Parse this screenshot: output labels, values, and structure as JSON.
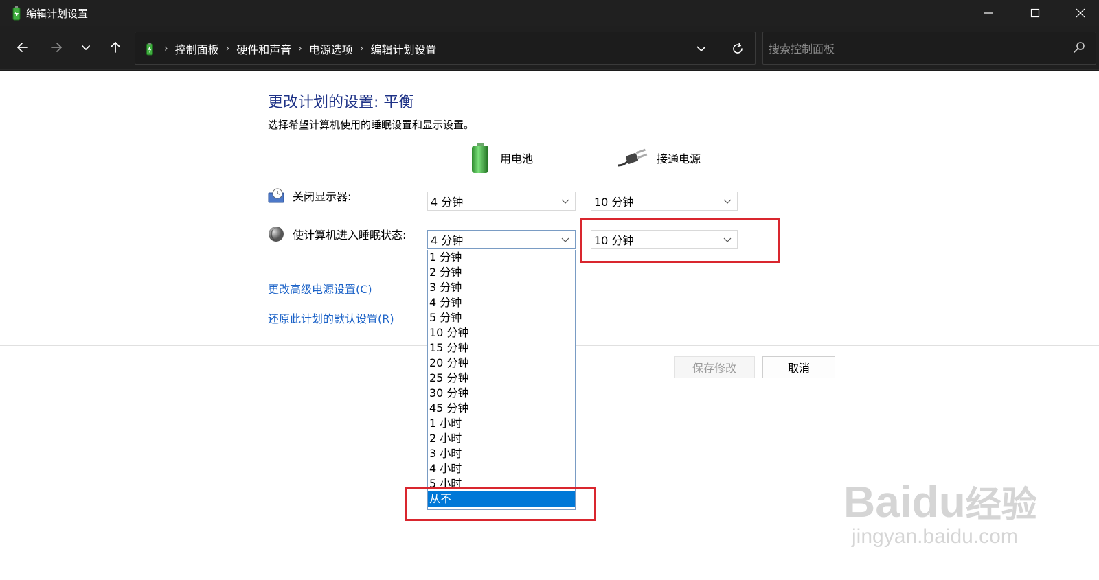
{
  "window": {
    "title": "编辑计划设置"
  },
  "breadcrumbs": [
    "控制面板",
    "硬件和声音",
    "电源选项",
    "编辑计划设置"
  ],
  "search": {
    "placeholder": "搜索控制面板"
  },
  "main": {
    "heading": "更改计划的设置: 平衡",
    "subtitle": "选择希望计算机使用的睡眠设置和显示设置。",
    "columns": {
      "battery": "用电池",
      "plugged": "接通电源"
    },
    "display_off": {
      "label": "关闭显示器:",
      "battery_value": "4 分钟",
      "plugged_value": "10 分钟"
    },
    "sleep": {
      "label": "使计算机进入睡眠状态:",
      "battery_value": "4 分钟",
      "plugged_value": "10 分钟"
    },
    "dropdown_options": [
      "1 分钟",
      "2 分钟",
      "3 分钟",
      "4 分钟",
      "5 分钟",
      "10 分钟",
      "15 分钟",
      "20 分钟",
      "25 分钟",
      "30 分钟",
      "45 分钟",
      "1 小时",
      "2 小时",
      "3 小时",
      "4 小时",
      "5 小时",
      "从不"
    ],
    "dropdown_selected": "从不",
    "links": {
      "advanced": "更改高级电源设置(C)",
      "restore": "还原此计划的默认设置(R)"
    },
    "buttons": {
      "save": "保存修改",
      "cancel": "取消"
    }
  },
  "watermark": {
    "brand": "Baidu",
    "brand_cn": "经验",
    "url": "jingyan.baidu.com"
  },
  "colors": {
    "accent": "#0078d7",
    "heading": "#1e3287",
    "link": "#1e64c8",
    "highlight": "#d9262e"
  }
}
